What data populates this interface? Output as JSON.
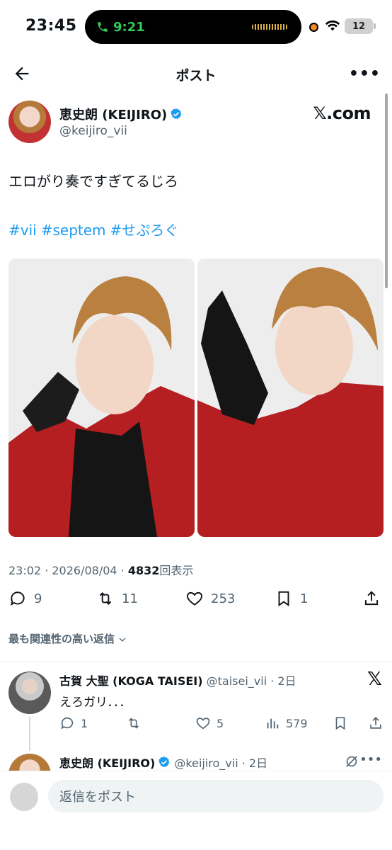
{
  "status_bar": {
    "time": "23:45",
    "call_time": "9:21",
    "battery": "12"
  },
  "nav": {
    "title": "ポスト"
  },
  "post": {
    "author_name": "恵史朗 (KEIJIRO)",
    "author_handle": "@keijiro_vii",
    "site_badge": "𝕏.com",
    "text": "エロがり奏ですぎてるじろ",
    "hashtags": [
      "#vii",
      "#septem",
      "#せぷろぐ"
    ],
    "time_date": "23:02 · 2026/08/04 · ",
    "views_count": "4832",
    "views_label": "回表示",
    "replies": "9",
    "reposts": "11",
    "likes": "253",
    "bookmarks": "1"
  },
  "sort_label": "最も関連性の高い返信",
  "reply": {
    "name": "古賀 大聖 (KOGA TAISEI)",
    "handle_time": "@taisei_vii · 2日",
    "text": "えろガリ．．．",
    "replies": "1",
    "likes": "5",
    "views": "579"
  },
  "reply2": {
    "name": "恵史朗 (KEIJIRO)",
    "handle_time": "@keijiro_vii · 2日"
  },
  "compose": {
    "placeholder": "返信をポスト"
  },
  "colors": {
    "link": "#1d9bf0",
    "muted": "#536471",
    "call_green": "#34c759"
  }
}
